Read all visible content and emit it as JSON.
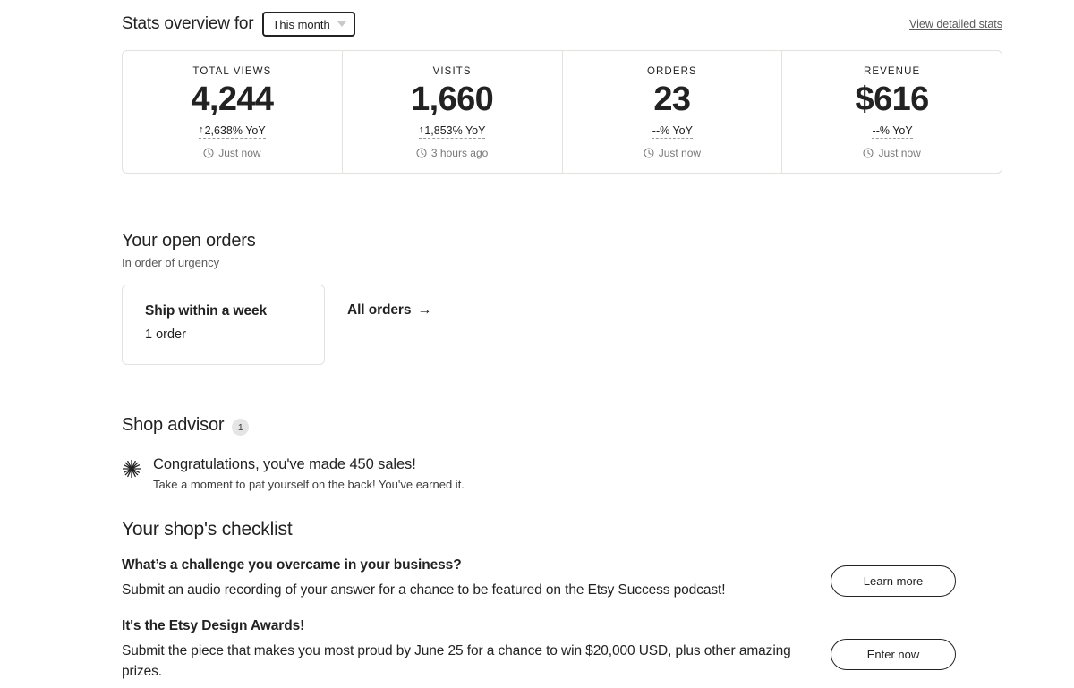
{
  "stats_overview": {
    "title": "Stats overview for",
    "period_value": "This month",
    "caret_icon": "chevron-down-icon",
    "detail_link": "View detailed stats",
    "cards": [
      {
        "label": "TOTAL VIEWS",
        "value": "4,244",
        "yoy_arrow": "↑",
        "yoy": "2,638% YoY",
        "time_icon": "clock-icon",
        "time": "Just now"
      },
      {
        "label": "VISITS",
        "value": "1,660",
        "yoy_arrow": "↑",
        "yoy": "1,853% YoY",
        "time_icon": "clock-icon",
        "time": "3 hours ago"
      },
      {
        "label": "ORDERS",
        "value": "23",
        "yoy_arrow": "",
        "yoy": "--% YoY",
        "time_icon": "clock-icon",
        "time": "Just now"
      },
      {
        "label": "REVENUE",
        "value": "$616",
        "yoy_arrow": "",
        "yoy": "--% YoY",
        "time_icon": "clock-icon",
        "time": "Just now"
      }
    ]
  },
  "open_orders": {
    "title": "Your open orders",
    "subtitle": "In order of urgency",
    "card": {
      "title": "Ship within a week",
      "count": "1 order"
    },
    "all_orders_label": "All orders",
    "all_orders_arrow": "→"
  },
  "shop_advisor": {
    "title": "Shop advisor",
    "badge_count": "1",
    "item": {
      "icon": "sparkle-icon",
      "headline": "Congratulations, you've made 450 sales!",
      "subtext": "Take a moment to pat yourself on the back! You've earned it."
    }
  },
  "checklist": {
    "title": "Your shop's checklist",
    "items": [
      {
        "heading": "What’s a challenge you overcame in your business?",
        "body": "Submit an audio recording of your answer for a chance to be featured on the Etsy Success podcast!",
        "button": "Learn more"
      },
      {
        "heading": "It's the Etsy Design Awards!",
        "body": "Submit the piece that makes you most proud by June 25 for a chance to win $20,000 USD, plus other amazing prizes.",
        "button": "Enter now"
      }
    ]
  },
  "colors": {
    "text": "#222222",
    "muted": "#595959",
    "border": "#e1e3df",
    "badge_bg": "#e5e5e5"
  }
}
